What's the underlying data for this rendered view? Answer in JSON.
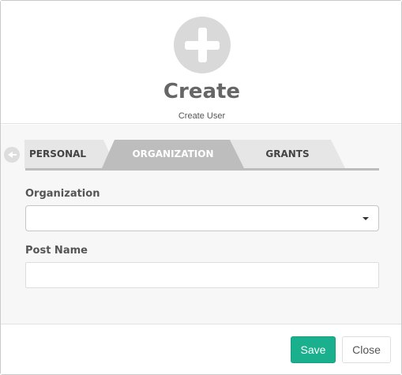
{
  "header": {
    "title": "Create",
    "subtitle": "Create User",
    "icon": "plus-circle-icon"
  },
  "tabs": [
    {
      "label": "PERSONAL",
      "active": false
    },
    {
      "label": "ORGANIZATION",
      "active": true
    },
    {
      "label": "GRANTS",
      "active": false
    }
  ],
  "form": {
    "organization": {
      "label": "Organization",
      "value": ""
    },
    "post_name": {
      "label": "Post Name",
      "value": "",
      "placeholder": ""
    }
  },
  "footer": {
    "save_label": "Save",
    "close_label": "Close"
  },
  "colors": {
    "accent": "#1aaf8d",
    "active_tab": "#bdbdbd",
    "inactive_tab": "#e6e6e6"
  }
}
